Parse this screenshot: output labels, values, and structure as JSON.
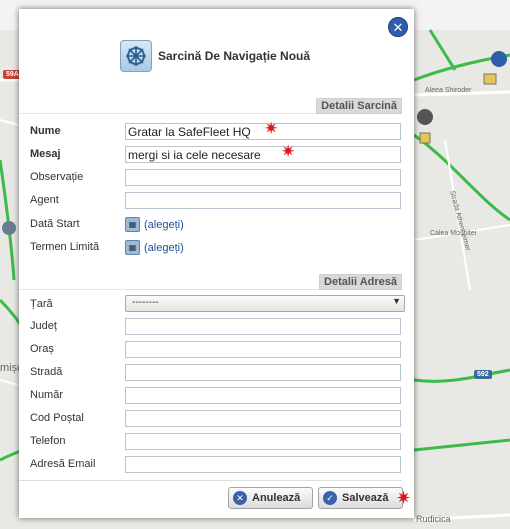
{
  "dialog": {
    "title": "Sarcină De Navigație Nouă",
    "task_section": "Detalii Sarcină",
    "address_section": "Detalii Adresă"
  },
  "task_fields": [
    {
      "label": "Nume",
      "value": "Gratar la SafeFleet HQ"
    },
    {
      "label": "Mesaj",
      "value": "mergi si ia cele necesare"
    },
    {
      "label": "Observație",
      "value": ""
    },
    {
      "label": "Agent",
      "value": ""
    }
  ],
  "date_fields": [
    {
      "label": "Dată Start",
      "link": "(alegeți)"
    },
    {
      "label": "Termen Limită",
      "link": "(alegeți)"
    }
  ],
  "address_fields": {
    "country_label": "Țară",
    "country_value": "--------",
    "fields": [
      "Județ",
      "Oraș",
      "Stradă",
      "Număr",
      "Cod Poștal",
      "Telefon",
      "Adresă Email"
    ]
  },
  "buttons": {
    "cancel": "Anulează",
    "save": "Salvează"
  },
  "map": {
    "labels": {
      "shield_left": "59A",
      "street_1": "Aleea Shiroder",
      "street_2": "Strada Athenheimer",
      "street_3": "Calea Moșniței",
      "shield_right": "592",
      "place_left": "mișc",
      "place_bottom": "Rudicica"
    }
  },
  "colors": {
    "accent": "#2f5fa8",
    "required_star": "#e0161b",
    "section_header_bg": "#d9d9d9"
  }
}
